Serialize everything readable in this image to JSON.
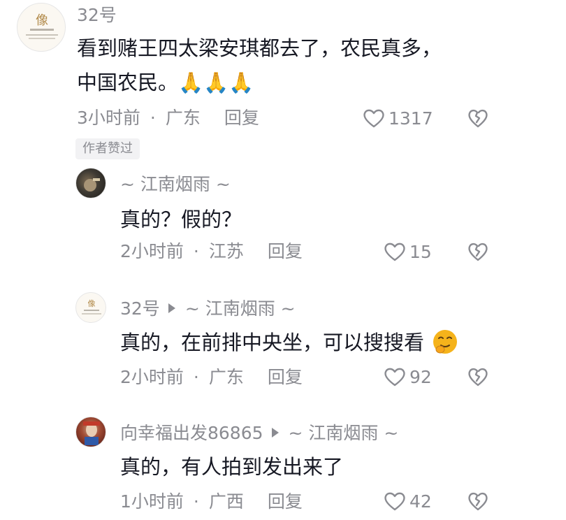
{
  "comments": [
    {
      "username": "32号",
      "text_lines": [
        "看到赌王四太梁安琪都去了，农民真多，",
        "中国农民。🙏🙏🙏"
      ],
      "time": "3小时前",
      "location": "广东",
      "reply_label": "回复",
      "likes": "1317",
      "badge": "作者赞过",
      "avatar_icon": "brand-logo-avatar"
    }
  ],
  "replies": [
    {
      "username": "~ 江南烟雨 ~",
      "reply_to": "",
      "text": "真的？假的？",
      "time": "2小时前",
      "location": "江苏",
      "reply_label": "回复",
      "likes": "15",
      "avatar_icon": "photo-avatar"
    },
    {
      "username": "32号",
      "reply_to": "~ 江南烟雨 ~",
      "text": "真的，在前排中央坐，可以搜搜看",
      "emoji": "smirk-emoji",
      "time": "2小时前",
      "location": "广东",
      "reply_label": "回复",
      "likes": "92",
      "avatar_icon": "brand-logo-avatar"
    },
    {
      "username": "向幸福出发86865",
      "reply_to": "~ 江南烟雨 ~",
      "text": "真的，有人拍到发出来了",
      "time": "1小时前",
      "location": "广西",
      "reply_label": "回复",
      "likes": "42",
      "avatar_icon": "opera-photo-avatar"
    }
  ],
  "separator_dot": "·",
  "colors": {
    "text": "#161823",
    "secondary": "#8a8b91",
    "badge_bg": "#f2f2f4",
    "emoji_yellow": "#f5b31b"
  }
}
